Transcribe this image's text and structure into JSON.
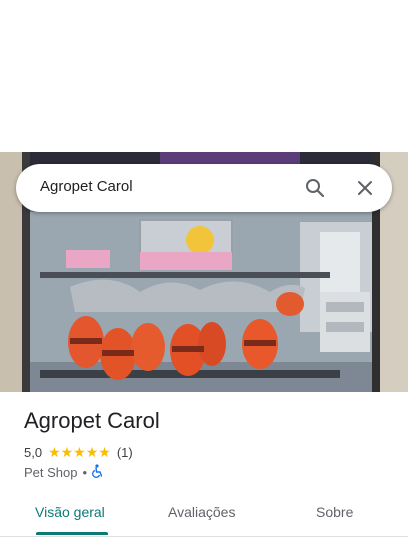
{
  "search": {
    "query": "Agropet Carol"
  },
  "place": {
    "name": "Agropet Carol",
    "rating": "5,0",
    "stars": "★★★★★",
    "review_count": "(1)",
    "category": "Pet Shop",
    "separator": "•"
  },
  "tabs": [
    {
      "label": "Visão geral",
      "active": true
    },
    {
      "label": "Avaliações",
      "active": false
    },
    {
      "label": "Sobre",
      "active": false
    }
  ],
  "colors": {
    "accent": "#0b7a75",
    "star": "#fbbc04",
    "accessible": "#1a73e8"
  },
  "icons": {
    "search": "search-icon",
    "close": "close-icon",
    "accessibility": "wheelchair-icon"
  }
}
